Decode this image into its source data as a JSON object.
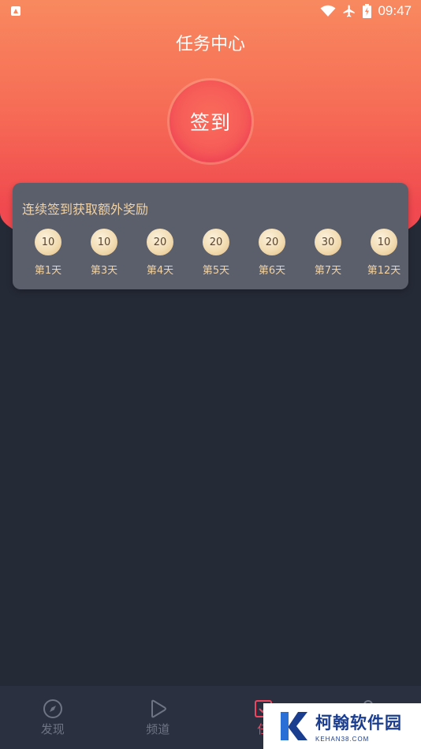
{
  "status_bar": {
    "time": "09:47"
  },
  "header": {
    "title": "任务中心"
  },
  "checkin": {
    "label": "签到"
  },
  "reward_card": {
    "title": "连续签到获取额外奖励",
    "items": [
      {
        "points": "10",
        "day": "第1天"
      },
      {
        "points": "10",
        "day": "第3天"
      },
      {
        "points": "20",
        "day": "第4天"
      },
      {
        "points": "20",
        "day": "第5天"
      },
      {
        "points": "20",
        "day": "第6天"
      },
      {
        "points": "30",
        "day": "第7天"
      },
      {
        "points": "10",
        "day": "第12天"
      }
    ]
  },
  "tab_bar": {
    "tabs": [
      {
        "label": "发现",
        "icon": "compass-icon",
        "active": false
      },
      {
        "label": "频道",
        "icon": "play-icon",
        "active": false
      },
      {
        "label": "任",
        "icon": "task-check-icon",
        "active": true
      },
      {
        "label": "",
        "icon": "person-icon",
        "active": false
      }
    ]
  },
  "watermark": {
    "text": "柯翰软件园",
    "sub": "KEHAN38.COM"
  },
  "colors": {
    "accent": "#f0455e",
    "header_top": "#f8895f",
    "header_bottom": "#f0494f",
    "background": "#252a37",
    "card": "#5b5f6c",
    "gold_text": "#f2d2a2"
  }
}
